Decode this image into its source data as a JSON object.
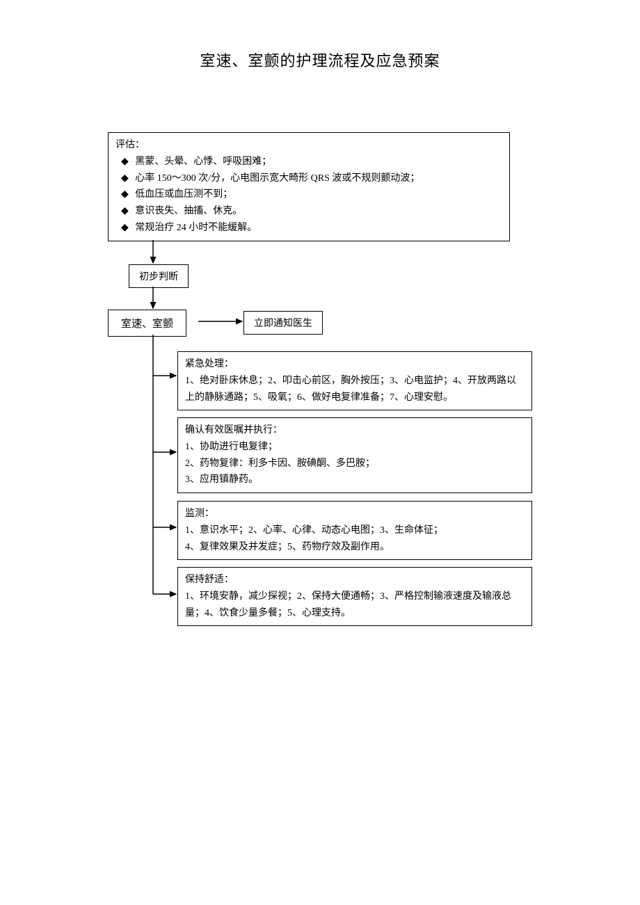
{
  "title": "室速、室颤的护理流程及应急预案",
  "evaluate": {
    "heading": "评估：",
    "items": [
      "黑蒙、头晕、心悸、呼吸困难；",
      "心率 150～300 次/分，心电图示宽大畸形 QRS 波或不规则颤动波；",
      "低血压或血压测不到；",
      "意识丧失、抽搐、休克。",
      "常规治疗 24 小时不能缓解。"
    ]
  },
  "prelim": "初步判断",
  "diagnosis": "室速、室颤",
  "notify": "立即通知医生",
  "emergency": {
    "heading": "紧急处理：",
    "body": "1、绝对卧床休息；2、叩击心前区，胸外按压；3、心电监护；4、开放两路以上的静脉通路；5、吸氧；6、做好电复律准备；7、心理安慰。"
  },
  "confirm": {
    "heading": "确认有效医嘱并执行：",
    "line1": "1、协助进行电复律；",
    "line2": "2、药物复律：利多卡因、胺碘酮、多巴胺；",
    "line3": "3、应用镇静药。"
  },
  "monitor": {
    "heading": "监测：",
    "line1": "1、意识水平；2、心率、心律、动态心电图；3、生命体征；",
    "line2": "4、复律效果及并发症；5、药物疗效及副作用。"
  },
  "comfort": {
    "heading": "保持舒适：",
    "body": "1、环境安静，减少探视；2、保持大便通畅；3、严格控制输液速度及输液总量；4、饮食少量多餐；5、心理支持。"
  }
}
